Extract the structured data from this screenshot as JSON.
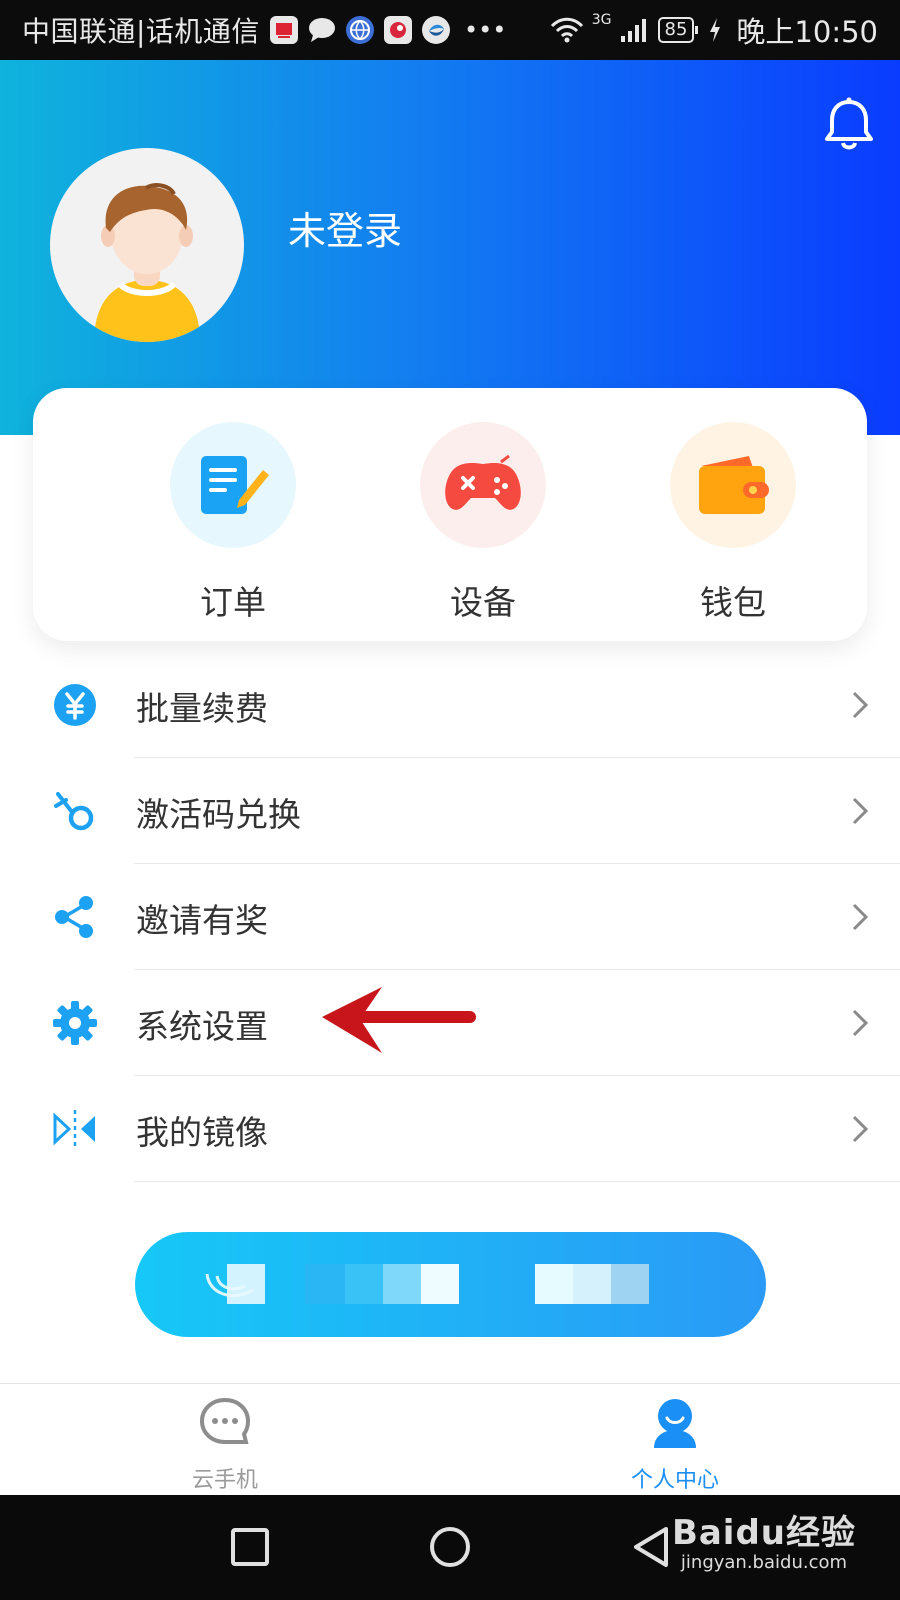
{
  "status_bar": {
    "carrier": "中国联通|话机通信",
    "network": "3G",
    "battery": "85",
    "time": "晚上10:50"
  },
  "header": {
    "username": "未登录",
    "bell_icon": "bell-icon"
  },
  "quick_actions": [
    {
      "label": "订单",
      "icon": "order-notepad-icon",
      "color": "#1aa3f5"
    },
    {
      "label": "设备",
      "icon": "gamepad-icon",
      "color": "#f44a3f"
    },
    {
      "label": "钱包",
      "icon": "wallet-icon",
      "color": "#ff9a00"
    }
  ],
  "menu": [
    {
      "label": "批量续费",
      "icon": "yen-coin-icon"
    },
    {
      "label": "激活码兑换",
      "icon": "activation-code-icon"
    },
    {
      "label": "邀请有奖",
      "icon": "share-icon"
    },
    {
      "label": "系统设置",
      "icon": "gear-icon"
    },
    {
      "label": "我的镜像",
      "icon": "mirror-icon"
    }
  ],
  "tabs": [
    {
      "label": "云手机",
      "icon": "chat-bubble-icon",
      "active": false
    },
    {
      "label": "个人中心",
      "icon": "person-icon",
      "active": true
    }
  ],
  "watermark": {
    "title": "Baidu经验",
    "url": "jingyan.baidu.com"
  },
  "colors": {
    "accent": "#1a8ff5",
    "header_gradient_start": "#0fb3dc",
    "header_gradient_end": "#0a3cff",
    "annotation_arrow": "#c8151b"
  }
}
